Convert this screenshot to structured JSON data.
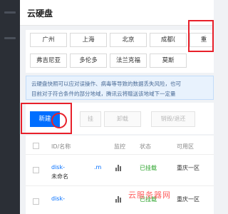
{
  "header": {
    "title": "云硬盘"
  },
  "regions": {
    "row1": [
      "广州",
      "上海",
      "北京",
      "成都(",
      "重"
    ],
    "row2": [
      "弗吉尼亚",
      "多伦多",
      "法兰克福",
      "莫斯"
    ]
  },
  "notice": {
    "line1": "云硬盘快照可以应对误操作、病毒等导致的数据丢失风险，也可",
    "line2": "目前对于符合条件的部分地域，腾讯云将赠送该地域下一定量"
  },
  "toolbar": {
    "new_label": "新建",
    "btn2_label": "挂",
    "btn3_label": "卸载",
    "btn4_label": "销毁/退还"
  },
  "table": {
    "columns": [
      "ID/名称",
      "监控",
      "状态",
      "可用区"
    ],
    "rows": [
      {
        "id": "disk-",
        "name": "未命名",
        "id_suffix": ".m",
        "status": "已挂载",
        "zone": "重庆一区"
      },
      {
        "id": "disk-",
        "name": "",
        "id_suffix": "",
        "status": "已挂载",
        "zone": "重庆一区"
      }
    ]
  },
  "watermark": "云服务器网",
  "colors": {
    "primary": "#006eff",
    "highlight": "#e8202a",
    "nav": "#2b2f36"
  }
}
